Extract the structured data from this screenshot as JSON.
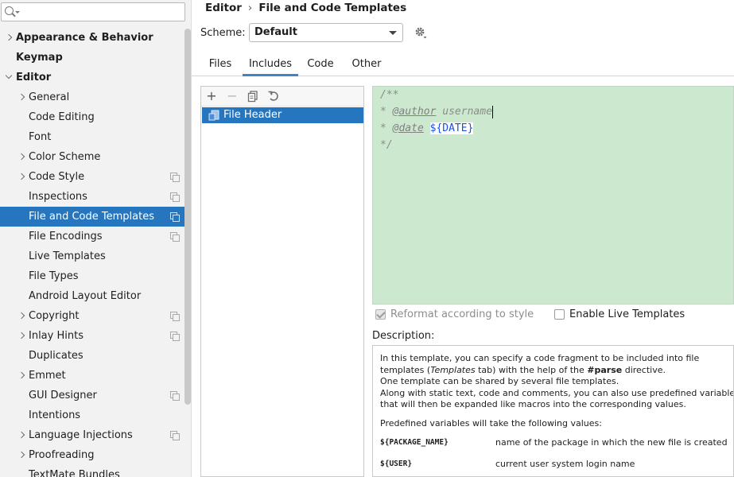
{
  "search": {
    "placeholder": ""
  },
  "sidebar": {
    "items": [
      {
        "label": "Appearance & Behavior",
        "level": 0,
        "arrow": "right",
        "bold": true,
        "selected": false,
        "project_icon": false
      },
      {
        "label": "Keymap",
        "level": 0,
        "arrow": "none",
        "bold": true,
        "selected": false,
        "project_icon": false
      },
      {
        "label": "Editor",
        "level": 0,
        "arrow": "down",
        "bold": true,
        "selected": false,
        "project_icon": false
      },
      {
        "label": "General",
        "level": 1,
        "arrow": "right",
        "bold": false,
        "selected": false,
        "project_icon": false
      },
      {
        "label": "Code Editing",
        "level": 1,
        "arrow": "none",
        "bold": false,
        "selected": false,
        "project_icon": false
      },
      {
        "label": "Font",
        "level": 1,
        "arrow": "none",
        "bold": false,
        "selected": false,
        "project_icon": false
      },
      {
        "label": "Color Scheme",
        "level": 1,
        "arrow": "right",
        "bold": false,
        "selected": false,
        "project_icon": false
      },
      {
        "label": "Code Style",
        "level": 1,
        "arrow": "right",
        "bold": false,
        "selected": false,
        "project_icon": true
      },
      {
        "label": "Inspections",
        "level": 1,
        "arrow": "none",
        "bold": false,
        "selected": false,
        "project_icon": true
      },
      {
        "label": "File and Code Templates",
        "level": 1,
        "arrow": "none",
        "bold": false,
        "selected": true,
        "project_icon": true
      },
      {
        "label": "File Encodings",
        "level": 1,
        "arrow": "none",
        "bold": false,
        "selected": false,
        "project_icon": true
      },
      {
        "label": "Live Templates",
        "level": 1,
        "arrow": "none",
        "bold": false,
        "selected": false,
        "project_icon": false
      },
      {
        "label": "File Types",
        "level": 1,
        "arrow": "none",
        "bold": false,
        "selected": false,
        "project_icon": false
      },
      {
        "label": "Android Layout Editor",
        "level": 1,
        "arrow": "none",
        "bold": false,
        "selected": false,
        "project_icon": false
      },
      {
        "label": "Copyright",
        "level": 1,
        "arrow": "right",
        "bold": false,
        "selected": false,
        "project_icon": true
      },
      {
        "label": "Inlay Hints",
        "level": 1,
        "arrow": "right",
        "bold": false,
        "selected": false,
        "project_icon": true
      },
      {
        "label": "Duplicates",
        "level": 1,
        "arrow": "none",
        "bold": false,
        "selected": false,
        "project_icon": false
      },
      {
        "label": "Emmet",
        "level": 1,
        "arrow": "right",
        "bold": false,
        "selected": false,
        "project_icon": false
      },
      {
        "label": "GUI Designer",
        "level": 1,
        "arrow": "none",
        "bold": false,
        "selected": false,
        "project_icon": true
      },
      {
        "label": "Intentions",
        "level": 1,
        "arrow": "none",
        "bold": false,
        "selected": false,
        "project_icon": false
      },
      {
        "label": "Language Injections",
        "level": 1,
        "arrow": "right",
        "bold": false,
        "selected": false,
        "project_icon": true
      },
      {
        "label": "Proofreading",
        "level": 1,
        "arrow": "right",
        "bold": false,
        "selected": false,
        "project_icon": false
      },
      {
        "label": "TextMate Bundles",
        "level": 1,
        "arrow": "none",
        "bold": false,
        "selected": false,
        "project_icon": false
      }
    ]
  },
  "breadcrumb": {
    "parent": "Editor",
    "separator": "›",
    "current": "File and Code Templates"
  },
  "scheme": {
    "label": "Scheme:",
    "value": "Default"
  },
  "tabs": [
    {
      "label": "Files",
      "active": false
    },
    {
      "label": "Includes",
      "active": true
    },
    {
      "label": "Code",
      "active": false
    },
    {
      "label": "Other",
      "active": false
    }
  ],
  "toolbar": {
    "add": "+",
    "remove": "−",
    "copy": "copy-icon",
    "reset": "reset-icon"
  },
  "templates": [
    {
      "label": "File Header",
      "selected": true
    }
  ],
  "editor": {
    "line1": "/**",
    "line2_prefix": "* ",
    "author_tag": "@author",
    "author_value": " username",
    "line3_prefix": "* ",
    "date_tag": "@date",
    "date_space": " ",
    "date_macro": "${DATE}",
    "line4": "*/",
    "background": "#cce8cf"
  },
  "options": {
    "reformat": {
      "label": "Reformat according to style",
      "checked": true,
      "disabled": true
    },
    "live": {
      "label": "Enable Live Templates",
      "checked": false
    }
  },
  "description": {
    "label": "Description:",
    "lines": [
      "In this template, you can specify a code fragment to be included into file",
      "templates (",
      "Templates",
      " tab) with the help of the ",
      "#parse",
      " directive.",
      "One template can be shared by several file templates.",
      "Along with static text, code and comments, you can also use predefined variables",
      "that will then be expanded like macros into the corresponding values."
    ],
    "predefined": "Predefined variables will take the following values:",
    "vars": [
      {
        "name": "${PACKAGE_NAME}",
        "desc": "name of the package in which the new file is created"
      },
      {
        "name": "${USER}",
        "desc": "current user system login name"
      }
    ]
  },
  "colors": {
    "selection": "#2675bf",
    "tab_underline": "#4083c9",
    "macro": "#1750eb"
  }
}
